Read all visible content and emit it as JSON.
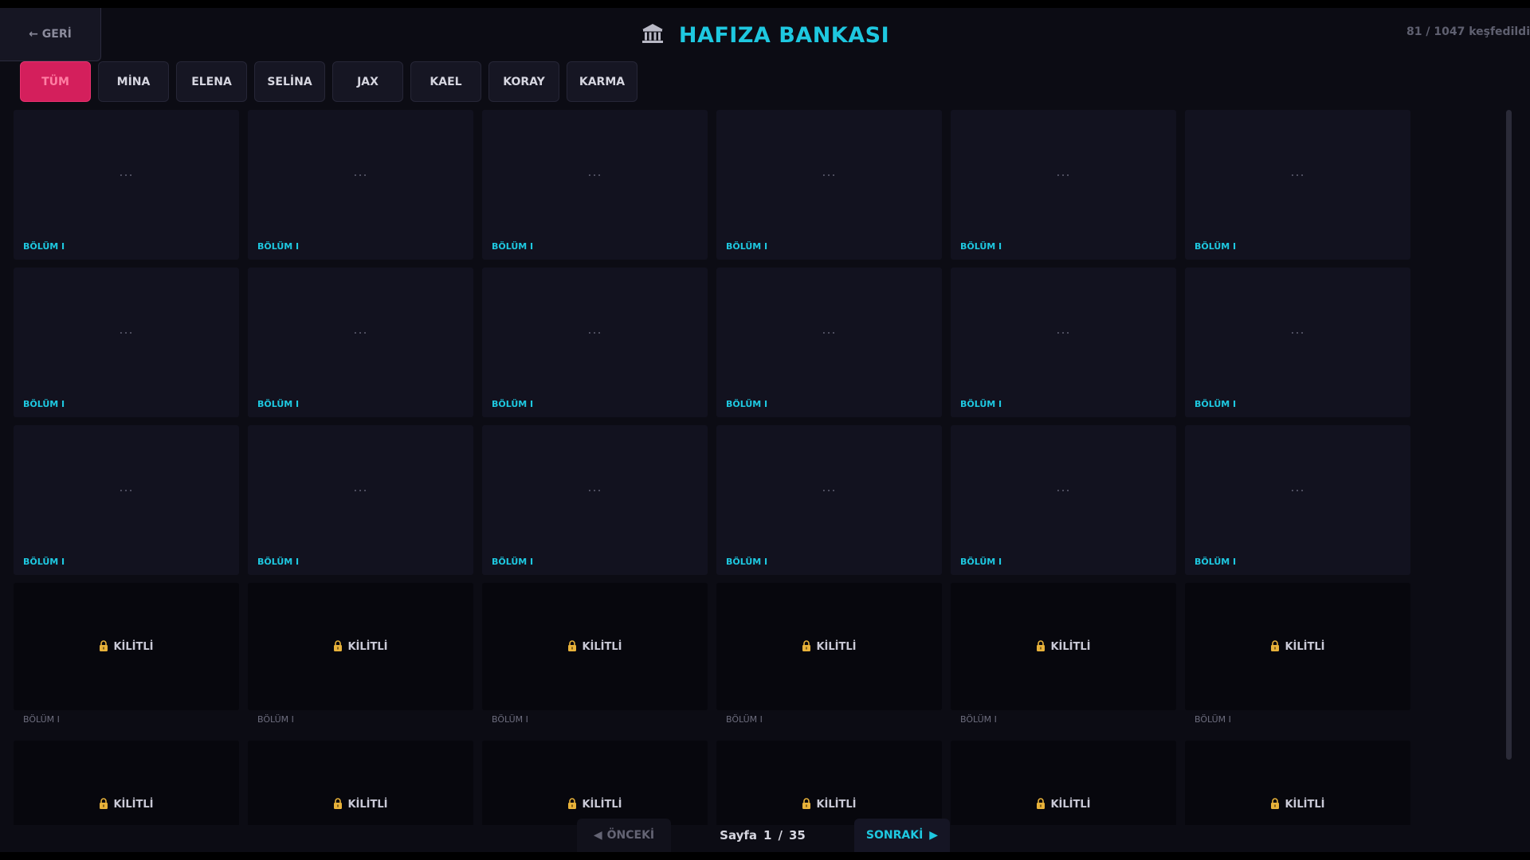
{
  "header": {
    "back_label": "← GERİ",
    "title": "HAFIZA BANKASI",
    "title_icon": "museum-icon",
    "progress": {
      "found": "81",
      "separator": "/",
      "total": "1047",
      "suffix": "keşfedildi"
    }
  },
  "tabs": [
    {
      "label": "TÜM",
      "active": true
    },
    {
      "label": "MİNA",
      "active": false
    },
    {
      "label": "ELENA",
      "active": false
    },
    {
      "label": "SELİNA",
      "active": false
    },
    {
      "label": "JAX",
      "active": false
    },
    {
      "label": "KAEL",
      "active": false
    },
    {
      "label": "KORAY",
      "active": false
    },
    {
      "label": "KARMA",
      "active": false
    }
  ],
  "cards": [
    {
      "state": "unlocked",
      "preview": "...",
      "label": "BÖLÜM I"
    },
    {
      "state": "unlocked",
      "preview": "...",
      "label": "BÖLÜM I"
    },
    {
      "state": "unlocked",
      "preview": "...",
      "label": "BÖLÜM I"
    },
    {
      "state": "unlocked",
      "preview": "...",
      "label": "BÖLÜM I"
    },
    {
      "state": "unlocked",
      "preview": "...",
      "label": "BÖLÜM I"
    },
    {
      "state": "unlocked",
      "preview": "...",
      "label": "BÖLÜM I"
    },
    {
      "state": "unlocked",
      "preview": "...",
      "label": "BÖLÜM I"
    },
    {
      "state": "unlocked",
      "preview": "...",
      "label": "BÖLÜM I"
    },
    {
      "state": "unlocked",
      "preview": "...",
      "label": "BÖLÜM I"
    },
    {
      "state": "unlocked",
      "preview": "...",
      "label": "BÖLÜM I"
    },
    {
      "state": "unlocked",
      "preview": "...",
      "label": "BÖLÜM I"
    },
    {
      "state": "unlocked",
      "preview": "...",
      "label": "BÖLÜM I"
    },
    {
      "state": "unlocked",
      "preview": "...",
      "label": "BÖLÜM I"
    },
    {
      "state": "unlocked",
      "preview": "...",
      "label": "BÖLÜM I"
    },
    {
      "state": "unlocked",
      "preview": "...",
      "label": "BÖLÜM I"
    },
    {
      "state": "unlocked",
      "preview": "...",
      "label": "BÖLÜM I"
    },
    {
      "state": "unlocked",
      "preview": "...",
      "label": "BÖLÜM I"
    },
    {
      "state": "unlocked",
      "preview": "...",
      "label": "BÖLÜM I"
    },
    {
      "state": "locked",
      "lock_text": "KİLİTLİ",
      "label": "BÖLÜM I"
    },
    {
      "state": "locked",
      "lock_text": "KİLİTLİ",
      "label": "BÖLÜM I"
    },
    {
      "state": "locked",
      "lock_text": "KİLİTLİ",
      "label": "BÖLÜM I"
    },
    {
      "state": "locked",
      "lock_text": "KİLİTLİ",
      "label": "BÖLÜM I"
    },
    {
      "state": "locked",
      "lock_text": "KİLİTLİ",
      "label": "BÖLÜM I"
    },
    {
      "state": "locked",
      "lock_text": "KİLİTLİ",
      "label": "BÖLÜM I"
    },
    {
      "state": "locked",
      "lock_text": "KİLİTLİ",
      "label": ""
    },
    {
      "state": "locked",
      "lock_text": "KİLİTLİ",
      "label": ""
    },
    {
      "state": "locked",
      "lock_text": "KİLİTLİ",
      "label": ""
    },
    {
      "state": "locked",
      "lock_text": "KİLİTLİ",
      "label": ""
    },
    {
      "state": "locked",
      "lock_text": "KİLİTLİ",
      "label": ""
    },
    {
      "state": "locked",
      "lock_text": "KİLİTLİ",
      "label": ""
    }
  ],
  "pagination": {
    "prev_label": "ÖNCEKİ",
    "page_word": "Sayfa",
    "current": "1",
    "separator": "/",
    "total": "35",
    "next_label": "SONRAKİ"
  },
  "colors": {
    "accent": "#1ec8e0",
    "active_tab": "#d41f5c",
    "background": "#0c0c14",
    "card": "#12121f",
    "lock_gold": "#e8b23a"
  }
}
